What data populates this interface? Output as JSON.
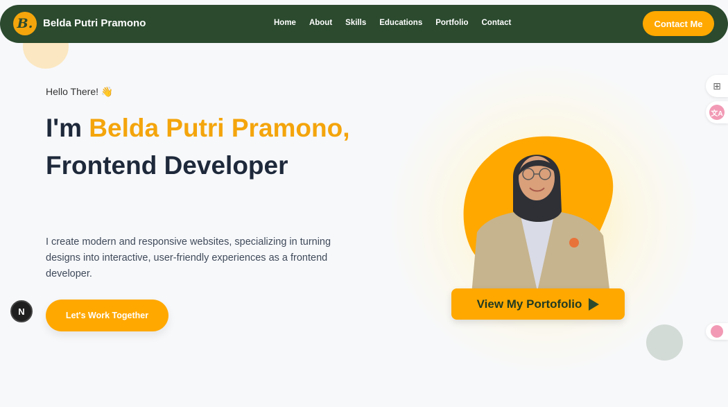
{
  "nav": {
    "logo_text": "B.",
    "brand": "Belda Putri Pramono",
    "items": [
      "Home",
      "About",
      "Skills",
      "Educations",
      "Portfolio",
      "Contact"
    ],
    "contact_label": "Contact Me"
  },
  "hero": {
    "greeting": "Hello There! 👋",
    "title_prefix": "I'm ",
    "title_name": "Belda Putri Pramono,",
    "title_role": "Frontend Developer",
    "description": "I create modern and responsive websites, specializing in turning designs into interactive, user-friendly experiences as a frontend developer.",
    "cta_label": "Let's Work Together",
    "portfolio_label": "View My Portofolio"
  },
  "widgets": {
    "next_badge": "N",
    "grid_icon": "grid-add-icon",
    "translate_icon": "translate-icon",
    "translate_text": "文A"
  },
  "colors": {
    "nav_bg": "#2b4a2e",
    "accent": "#ffa800",
    "text_dark": "#1e293b"
  }
}
